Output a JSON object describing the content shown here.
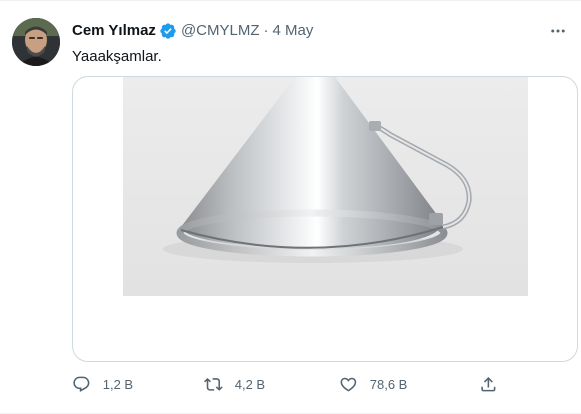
{
  "tweet": {
    "display_name": "Cem Yılmaz",
    "handle": "@CMYLMZ",
    "separator": "·",
    "timestamp": "4 May",
    "text": "Yaaakşamlar.",
    "verified_color": "#1d9bf0",
    "media": {
      "kind": "photo",
      "subject": "stainless steel conical funnel with side handle"
    }
  },
  "actions": {
    "reply": {
      "icon": "reply-icon",
      "count": "1,2 B"
    },
    "retweet": {
      "icon": "retweet-icon",
      "count": "4,2 B"
    },
    "like": {
      "icon": "heart-icon",
      "count": "78,6 B"
    },
    "share": {
      "icon": "share-icon"
    }
  },
  "colors": {
    "text": "#0f1419",
    "secondary": "#536471",
    "border": "#cfd9de",
    "accent": "#1d9bf0"
  }
}
